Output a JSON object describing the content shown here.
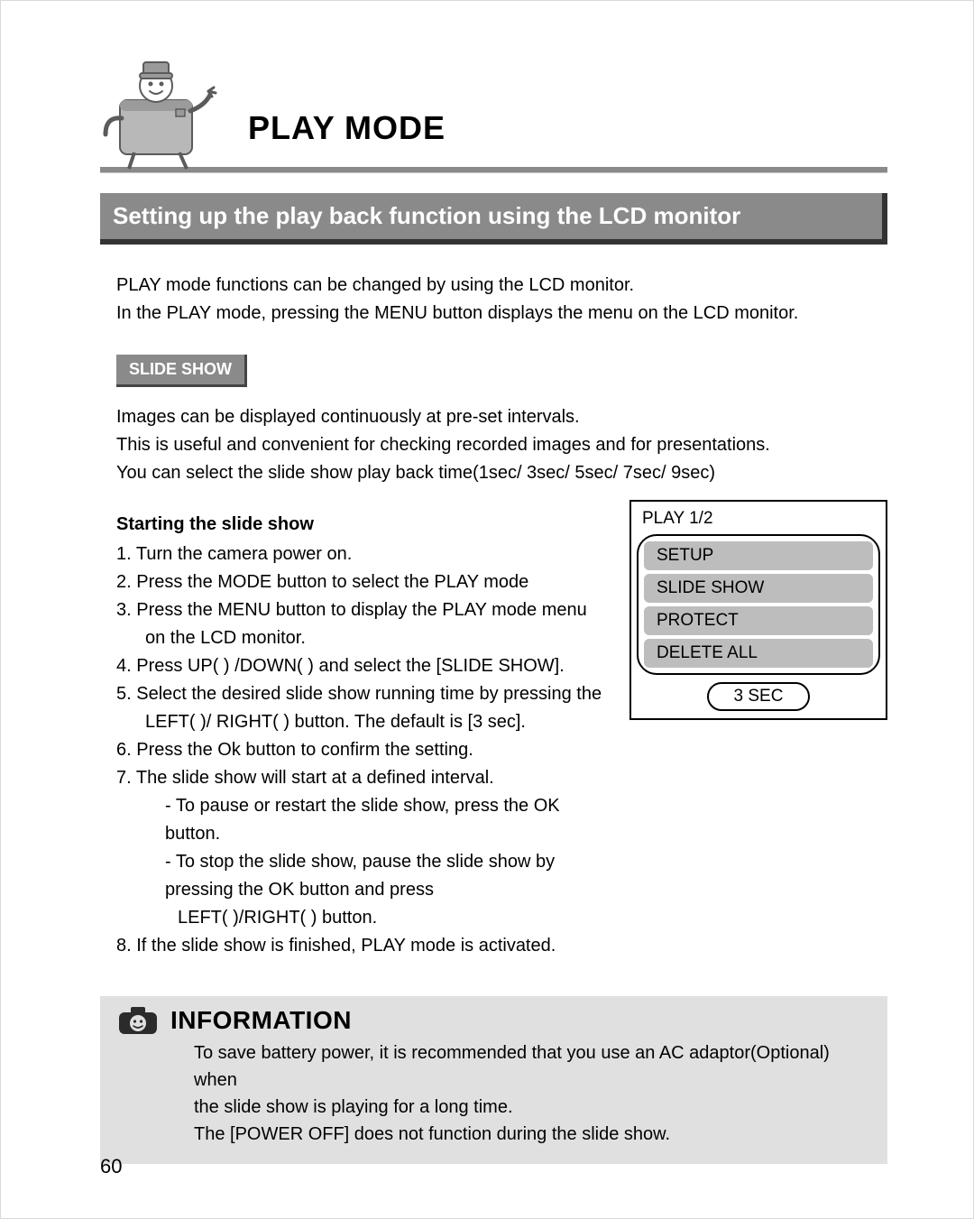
{
  "header": {
    "title": "PLAY MODE"
  },
  "section_bar": "Setting up the play back function using the LCD monitor",
  "intro": {
    "line1": "PLAY mode functions can be changed by using the LCD monitor.",
    "line2": "In the PLAY mode, pressing the MENU button displays the menu on the LCD monitor."
  },
  "tag": "SLIDE SHOW",
  "slide_desc": {
    "line1": "Images can be displayed continuously at pre-set intervals.",
    "line2": "This is useful and convenient for checking recorded images and for presentations.",
    "line3": "You can select the slide show play back time(1sec/ 3sec/ 5sec/ 7sec/ 9sec)"
  },
  "steps": {
    "subhead": "Starting the slide show",
    "s1": "1. Turn the camera power on.",
    "s2": "2. Press the MODE button to select the PLAY mode",
    "s3a": "3. Press the MENU button to display the PLAY mode menu",
    "s3b": "on the LCD monitor.",
    "s4": "4. Press UP(   ) /DOWN(   )  and select the [SLIDE SHOW].",
    "s5a": "5. Select the desired slide show running time by pressing the",
    "s5b": "LEFT(   )/ RIGHT(   ) button. The default is [3 sec].",
    "s6": "6. Press the Ok button to confirm the setting.",
    "s7": "7. The slide show will start at a defined interval.",
    "s7a": "- To pause or restart the slide show, press the OK button.",
    "s7b": "- To stop the slide show, pause the slide show by pressing the OK button and press",
    "s7c": "LEFT(   )/RIGHT(   ) button.",
    "s8": "8. If the slide show is finished, PLAY mode is activated."
  },
  "lcd": {
    "title": "PLAY 1/2",
    "items": [
      "SETUP",
      "SLIDE SHOW",
      "PROTECT",
      "DELETE ALL"
    ],
    "value": "3 SEC"
  },
  "info": {
    "label": "INFORMATION",
    "line1": "To save battery power, it is recommended that you use an AC adaptor(Optional) when",
    "line2": "the slide show is playing for a long time.",
    "line3": "The [POWER OFF] does not function during the slide show."
  },
  "page_number": "60"
}
